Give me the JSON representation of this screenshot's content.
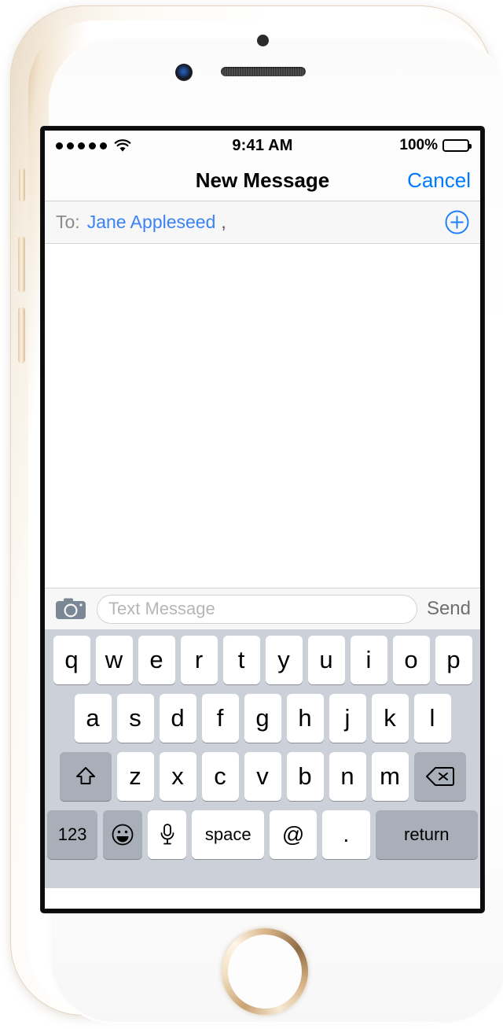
{
  "device": {
    "model": "iphone",
    "frame_color": "#e8d9c4",
    "hardware": {
      "proximity_sensor": "proximity-sensor",
      "front_camera": "front-camera",
      "earpiece": "earpiece-speaker",
      "home_button": "home-button",
      "silent_switch": "silent-switch",
      "volume_up": "volume-up-button",
      "volume_down": "volume-down-button",
      "power": "power-button"
    }
  },
  "status_bar": {
    "signal_dots": 5,
    "signal_filled": 5,
    "wifi_icon": "wifi-icon",
    "time": "9:41 AM",
    "battery_percent": "100%",
    "battery_level": 100,
    "battery_icon": "battery-icon"
  },
  "nav_bar": {
    "title": "New Message",
    "cancel_label": "Cancel",
    "accent_color": "#007AFF"
  },
  "to_field": {
    "label": "To:",
    "recipient": "Jane Appleseed",
    "separator": ",",
    "recipient_color": "#3b82f6",
    "add_contact_icon": "plus-circle-icon"
  },
  "conversation": {
    "messages": []
  },
  "input_toolbar": {
    "camera_icon": "camera-icon",
    "placeholder": "Text Message",
    "value": "",
    "send_label": "Send",
    "send_color": "#6f6f6f"
  },
  "keyboard": {
    "row1": [
      "q",
      "w",
      "e",
      "r",
      "t",
      "y",
      "u",
      "i",
      "o",
      "p"
    ],
    "row2": [
      "a",
      "s",
      "d",
      "f",
      "g",
      "h",
      "j",
      "k",
      "l"
    ],
    "row3": [
      "z",
      "x",
      "c",
      "v",
      "b",
      "n",
      "m"
    ],
    "shift_icon": "shift-icon",
    "delete_icon": "delete-icon",
    "numbers_label": "123",
    "emoji_icon": "emoji-icon",
    "dictation_icon": "microphone-icon",
    "space_label": "space",
    "at_label": "@",
    "period_label": ".",
    "return_label": "return",
    "background_color": "#ccd0d8",
    "key_color": "#ffffff",
    "modifier_key_color": "#a9afb9"
  }
}
